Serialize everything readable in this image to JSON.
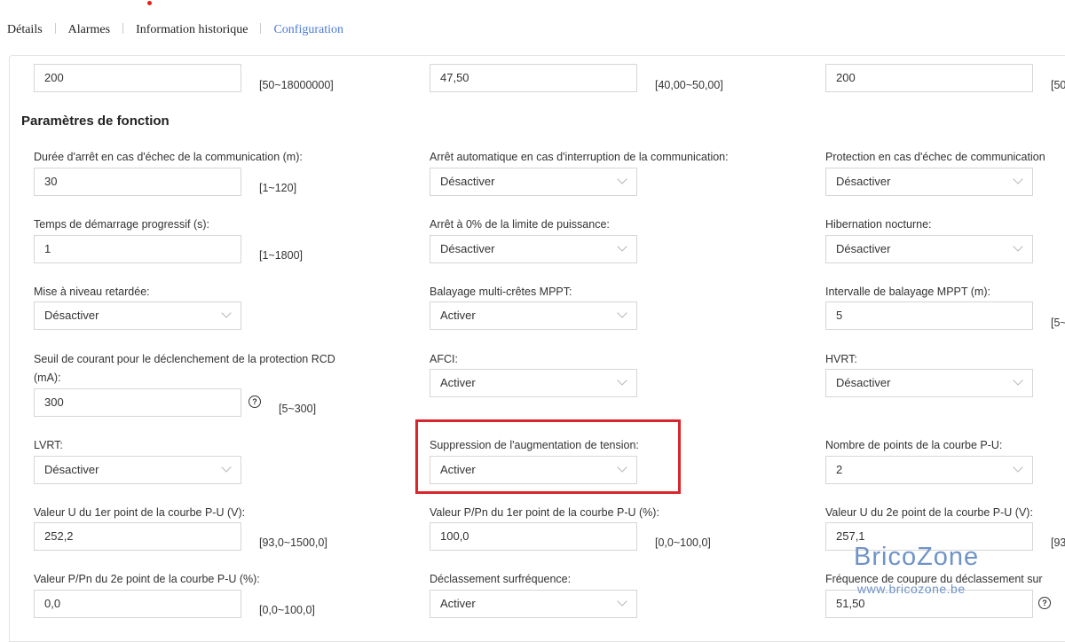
{
  "tabs": [
    "Détails",
    "Alarmes",
    "Information historique",
    "Configuration"
  ],
  "section_title": "Paramètres de fonction",
  "top_row": {
    "c1_value": "200",
    "c1_range": "[50~18000000]",
    "c2_value": "47,50",
    "c2_range": "[40,00~50,00]",
    "c3_value": "200",
    "c3_range": "[50"
  },
  "fields": {
    "comm_fail_delay": {
      "label": "Durée d'arrêt en cas d'échec de la communication (m):",
      "value": "30",
      "range": "[1~120]"
    },
    "auto_stop_comm": {
      "label": "Arrêt automatique en cas d'interruption de la communication:",
      "value": "Désactiver"
    },
    "comm_fail_protect": {
      "label": "Protection en cas d'échec de communication",
      "value": "Désactiver"
    },
    "soft_start": {
      "label": "Temps de démarrage progressif (s):",
      "value": "1",
      "range": "[1~1800]"
    },
    "stop_zero_power": {
      "label": "Arrêt à 0% de la limite de puissance:",
      "value": "Désactiver"
    },
    "night_hibernation": {
      "label": "Hibernation nocturne:",
      "value": "Désactiver"
    },
    "delayed_upgrade": {
      "label": "Mise à niveau retardée:",
      "value": "Désactiver"
    },
    "mppt_multi_peak": {
      "label": "Balayage multi-crêtes MPPT:",
      "value": "Activer"
    },
    "mppt_interval": {
      "label": "Intervalle de balayage MPPT (m):",
      "value": "5",
      "range": "[5~"
    },
    "rcd_threshold": {
      "label1": "Seuil de courant pour le déclenchement de la protection RCD",
      "label2": "(mA):",
      "value": "300",
      "range": "[5~300]"
    },
    "afci": {
      "label": "AFCI:",
      "value": "Activer"
    },
    "hvrt": {
      "label": "HVRT:",
      "value": "Désactiver"
    },
    "lvrt": {
      "label": "LVRT:",
      "value": "Désactiver"
    },
    "voltage_rise_suppr": {
      "label": "Suppression de l'augmentation de tension:",
      "value": "Activer"
    },
    "pu_points": {
      "label": "Nombre de points de la courbe P-U:",
      "value": "2"
    },
    "u_point1": {
      "label": "Valeur U du 1er point de la courbe P-U (V):",
      "value": "252,2",
      "range": "[93,0~1500,0]"
    },
    "ppn_point1": {
      "label": "Valeur P/Pn du 1er point de la courbe P-U (%):",
      "value": "100,0",
      "range": "[0,0~100,0]"
    },
    "u_point2": {
      "label": "Valeur U du 2e point de la courbe P-U (V):",
      "value": "257,1",
      "range": "[93"
    },
    "ppn_point2": {
      "label": "Valeur P/Pn du 2e point de la courbe P-U (%):",
      "value": "0,0",
      "range": "[0,0~100,0]"
    },
    "overfreq_derating": {
      "label": "Déclassement surfréquence:",
      "value": "Activer"
    },
    "cutoff_freq": {
      "label": "Fréquence de coupure du déclassement sur",
      "value": "51,50"
    }
  },
  "watermark": {
    "brand": "BricoZone",
    "url": "www.bricozone.be"
  },
  "colors": {
    "active_tab": "#4a78d6",
    "highlight": "#d7272d",
    "watermark": "#6f93c8"
  }
}
